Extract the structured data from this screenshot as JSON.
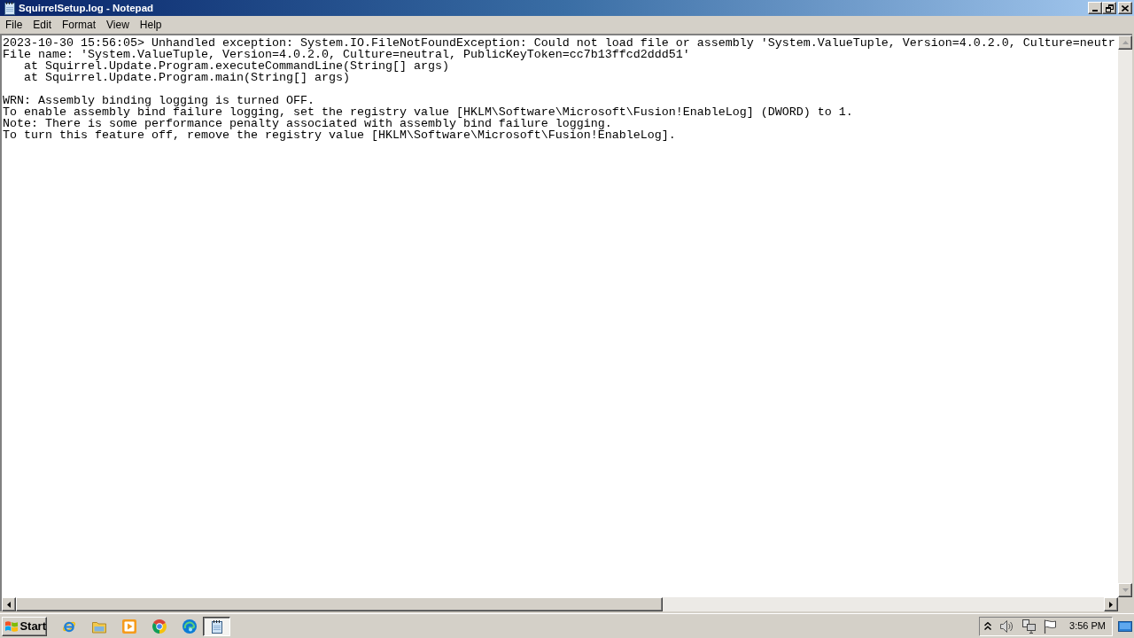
{
  "window": {
    "title": "SquirrelSetup.log - Notepad"
  },
  "menu": [
    "File",
    "Edit",
    "Format",
    "View",
    "Help"
  ],
  "document": {
    "paragraphs": [
      [
        "2023-10-30 15:56:05> Unhandled exception: System.IO.FileNotFoundException: Could not load file or assembly 'System.ValueTuple, Version=4.0.2.0, Culture=neutr",
        "File name: 'System.ValueTuple, Version=4.0.2.0, Culture=neutral, PublicKeyToken=cc7b13ffcd2ddd51'",
        "   at Squirrel.Update.Program.executeCommandLine(String[] args)",
        "   at Squirrel.Update.Program.main(String[] args)"
      ],
      [
        "WRN: Assembly binding logging is turned OFF.",
        "To enable assembly bind failure logging, set the registry value [HKLM\\Software\\Microsoft\\Fusion!EnableLog] (DWORD) to 1.",
        "Note: There is some performance penalty associated with assembly bind failure logging.",
        "To turn this feature off, remove the registry value [HKLM\\Software\\Microsoft\\Fusion!EnableLog]."
      ]
    ]
  },
  "taskbar": {
    "start": "Start",
    "task_buttons": [
      {
        "selected": true
      }
    ],
    "clock": "3:56 PM"
  }
}
